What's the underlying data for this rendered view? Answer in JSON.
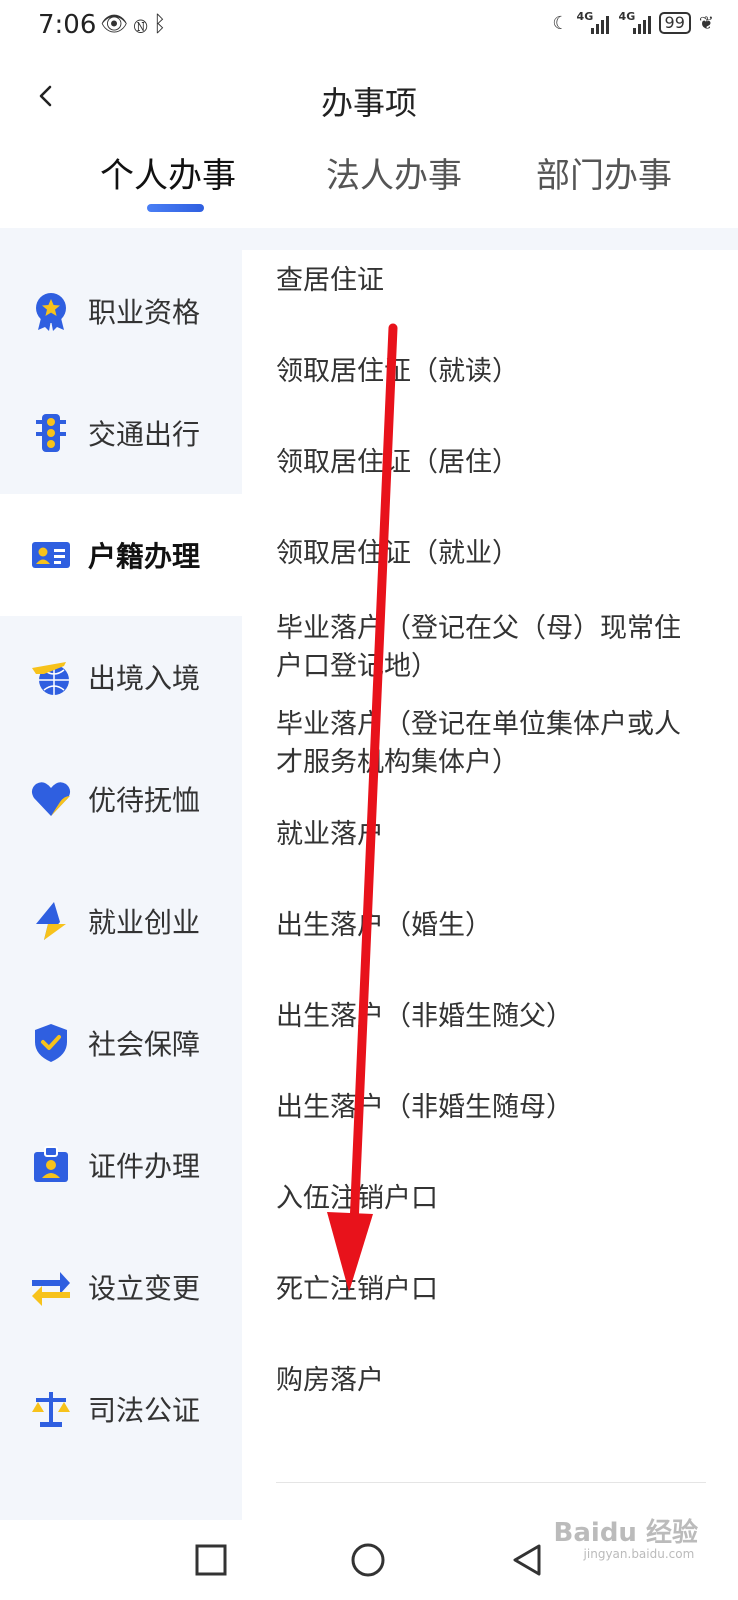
{
  "status_bar": {
    "time": "7:06",
    "battery": "99",
    "network": "4G"
  },
  "header": {
    "title": "办事项"
  },
  "tabs": [
    {
      "label": "个人办事",
      "active": true
    },
    {
      "label": "法人办事",
      "active": false
    },
    {
      "label": "部门办事",
      "active": false
    }
  ],
  "sidebar": {
    "items": [
      {
        "label": "职业资格",
        "icon": "medal-icon"
      },
      {
        "label": "交通出行",
        "icon": "traffic-light-icon"
      },
      {
        "label": "户籍办理",
        "icon": "id-card-icon",
        "active": true
      },
      {
        "label": "出境入境",
        "icon": "plane-globe-icon"
      },
      {
        "label": "优待抚恤",
        "icon": "heart-icon"
      },
      {
        "label": "就业创业",
        "icon": "lightning-icon"
      },
      {
        "label": "社会保障",
        "icon": "shield-check-icon"
      },
      {
        "label": "证件办理",
        "icon": "badge-icon"
      },
      {
        "label": "设立变更",
        "icon": "swap-arrows-icon"
      },
      {
        "label": "司法公证",
        "icon": "scales-icon"
      }
    ]
  },
  "content": {
    "items": [
      "查居住证",
      "领取居住证（就读）",
      "领取居住证（居住）",
      "领取居住证（就业）",
      "毕业落户（登记在父（母）现常住户口登记地）",
      "毕业落户（登记在单位集体户或人才服务机构集体户）",
      "就业落户",
      "出生落户（婚生）",
      "出生落户（非婚生随父）",
      "出生落户（非婚生随母）",
      "入伍注销户口",
      "死亡注销户口",
      "购房落户"
    ]
  },
  "watermark": {
    "brand": "Baidu 经验",
    "url": "jingyan.baidu.com"
  },
  "colors": {
    "accent": "#2f5fe0",
    "icon_yellow": "#f7c21b",
    "annotation": "#e8121b"
  }
}
